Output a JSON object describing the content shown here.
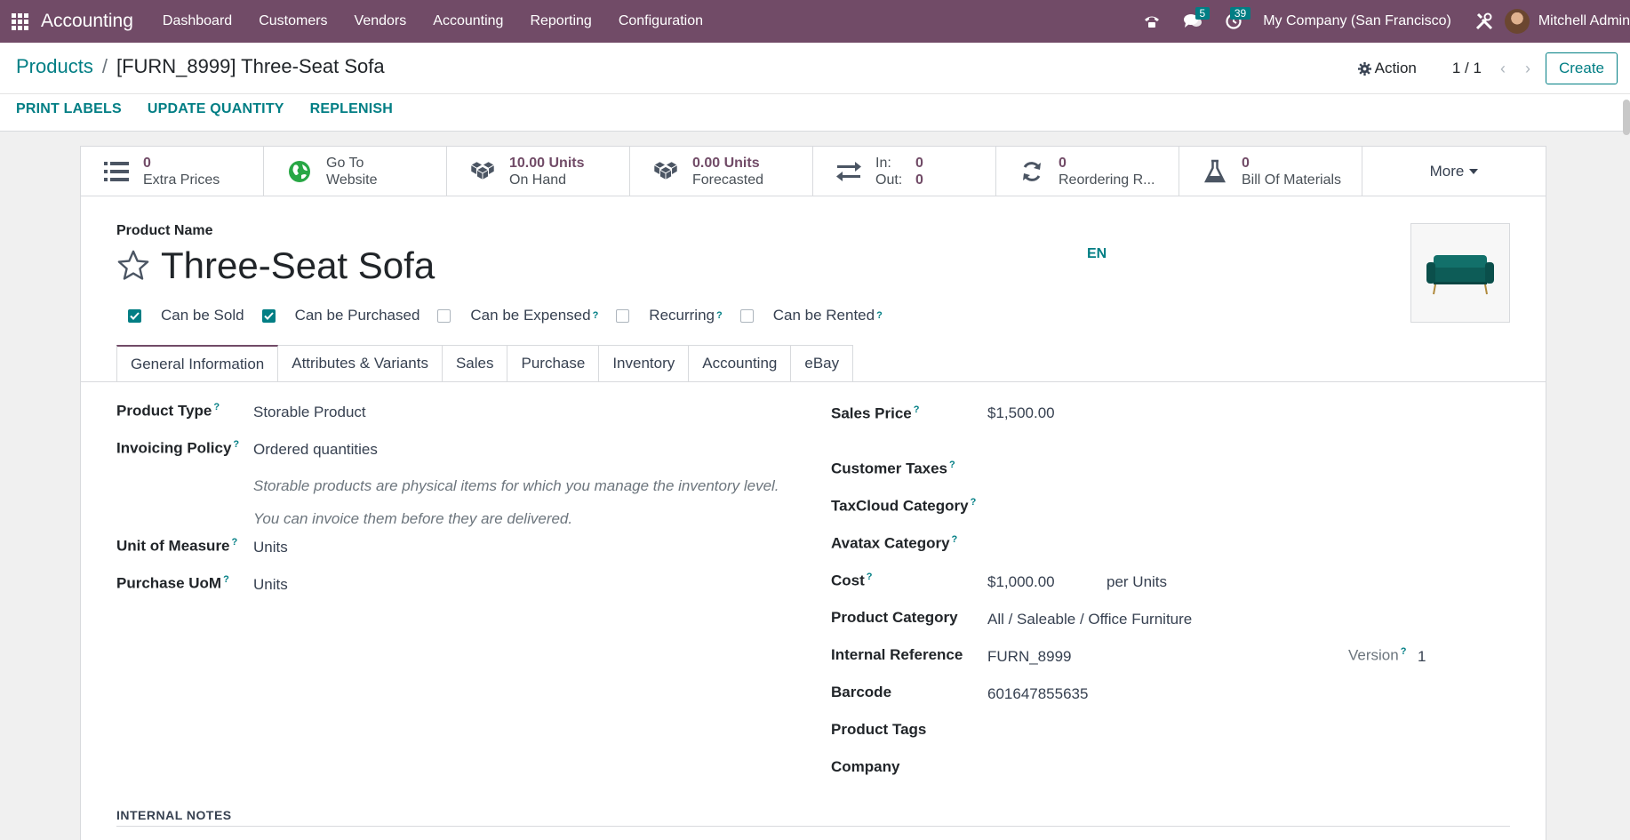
{
  "navbar": {
    "brand": "Accounting",
    "menu": [
      "Dashboard",
      "Customers",
      "Vendors",
      "Accounting",
      "Reporting",
      "Configuration"
    ],
    "messages_count": "5",
    "activities_count": "39",
    "company": "My Company (San Francisco)",
    "user": "Mitchell Admin"
  },
  "breadcrumb": {
    "parent": "Products",
    "separator": "/",
    "current": "[FURN_8999] Three-Seat Sofa"
  },
  "control": {
    "action_label": "Action",
    "pager": "1 / 1",
    "create_label": "Create"
  },
  "statusbar": {
    "buttons": [
      "PRINT LABELS",
      "UPDATE QUANTITY",
      "REPLENISH"
    ]
  },
  "smart_buttons": {
    "extra_prices": {
      "value": "0",
      "label": "Extra Prices"
    },
    "website": {
      "line1": "Go To",
      "line2": "Website"
    },
    "on_hand": {
      "value": "10.00 Units",
      "label": "On Hand"
    },
    "forecasted": {
      "value": "0.00 Units",
      "label": "Forecasted"
    },
    "in_out": {
      "in_label": "In:",
      "in_value": "0",
      "out_label": "Out:",
      "out_value": "0"
    },
    "reordering": {
      "value": "0",
      "label": "Reordering R..."
    },
    "bom": {
      "value": "0",
      "label": "Bill Of Materials"
    },
    "more": "More"
  },
  "product": {
    "name_caption": "Product Name",
    "name": "Three-Seat Sofa",
    "lang": "EN"
  },
  "checkboxes": [
    {
      "label": "Can be Sold",
      "checked": true,
      "help": ""
    },
    {
      "label": "Can be Purchased",
      "checked": true,
      "help": ""
    },
    {
      "label": "Can be Expensed",
      "checked": false,
      "help": "?"
    },
    {
      "label": "Recurring",
      "checked": false,
      "help": "?"
    },
    {
      "label": "Can be Rented",
      "checked": false,
      "help": "?"
    }
  ],
  "tabs": [
    "General Information",
    "Attributes & Variants",
    "Sales",
    "Purchase",
    "Inventory",
    "Accounting",
    "eBay"
  ],
  "left_fields": {
    "product_type": {
      "label": "Product Type",
      "value": "Storable Product"
    },
    "invoicing_policy": {
      "label": "Invoicing Policy",
      "value": "Ordered quantities"
    },
    "help1": "Storable products are physical items for which you manage the inventory level.",
    "help2": "You can invoice them before they are delivered.",
    "uom": {
      "label": "Unit of Measure",
      "value": "Units"
    },
    "purchase_uom": {
      "label": "Purchase UoM",
      "value": "Units"
    }
  },
  "right_fields": {
    "sales_price": {
      "label": "Sales Price",
      "value": "$1,500.00"
    },
    "customer_taxes": {
      "label": "Customer Taxes"
    },
    "taxcloud": {
      "label": "TaxCloud Category"
    },
    "avatax": {
      "label": "Avatax Category"
    },
    "cost": {
      "label": "Cost",
      "value": "$1,000.00",
      "suffix": "per Units"
    },
    "category": {
      "label": "Product Category",
      "value": "All / Saleable / Office Furniture"
    },
    "internal_ref": {
      "label": "Internal Reference",
      "value": "FURN_8999"
    },
    "version": {
      "label": "Version",
      "value": "1"
    },
    "barcode": {
      "label": "Barcode",
      "value": "601647855635"
    },
    "tags": {
      "label": "Product Tags"
    },
    "company": {
      "label": "Company"
    }
  },
  "help_mark": "?",
  "notes_title": "INTERNAL NOTES",
  "colors": {
    "brand": "#714B67",
    "accent": "#017e84"
  }
}
